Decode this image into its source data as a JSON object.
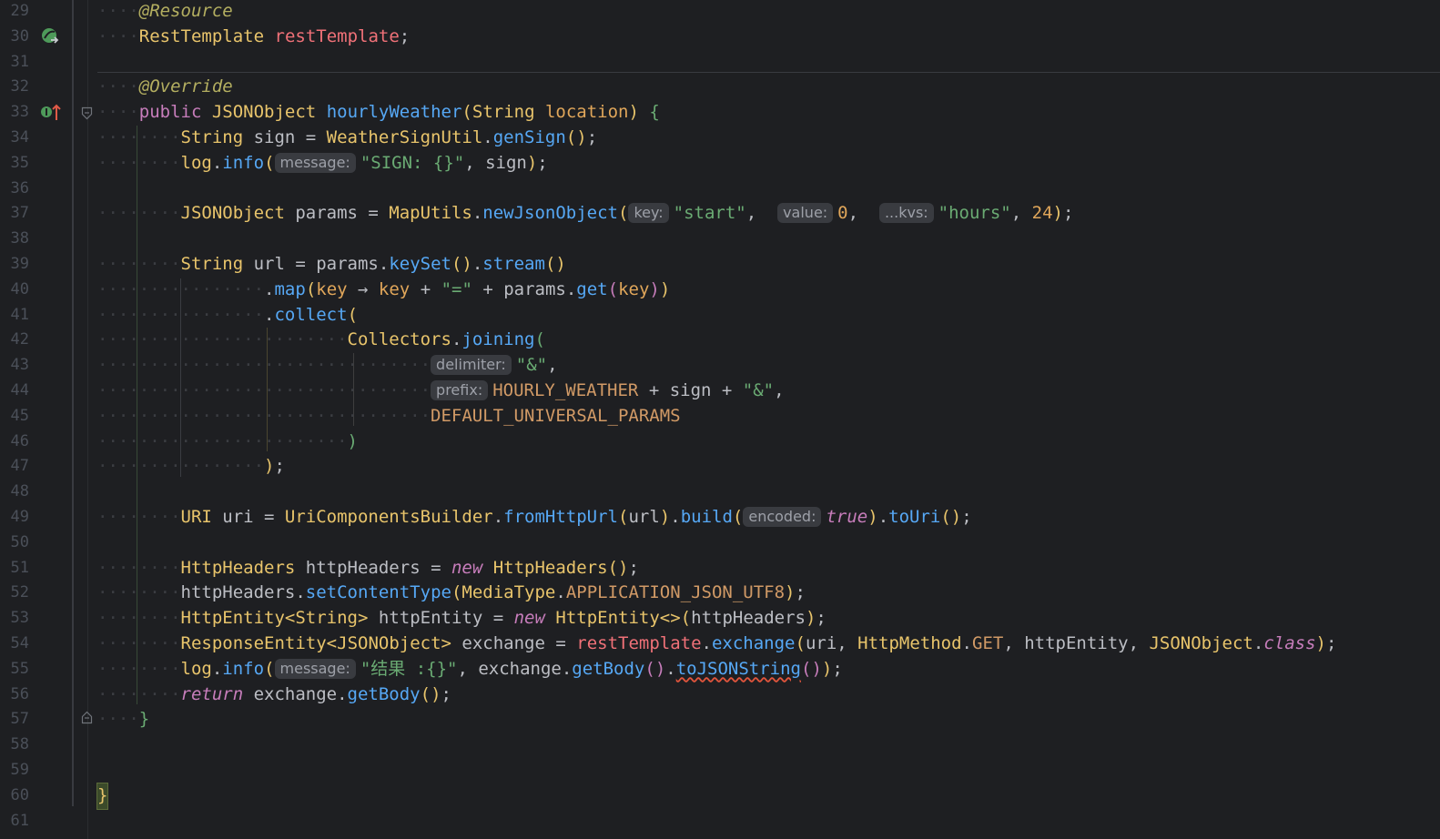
{
  "lines": [
    {
      "n": "29",
      "tokens": [
        [
          "ann",
          "@Resource"
        ]
      ]
    },
    {
      "n": "30",
      "tokens": [
        [
          "type",
          "RestTemplate"
        ],
        [
          "plain",
          " "
        ],
        [
          "field",
          "restTemplate"
        ],
        [
          "plain",
          ";"
        ]
      ]
    },
    {
      "n": "31",
      "tokens": []
    },
    {
      "n": "32",
      "tokens": [
        [
          "ann",
          "@Override"
        ]
      ]
    },
    {
      "n": "33",
      "tokens": [
        [
          "kwp",
          "public"
        ],
        [
          "plain",
          " "
        ],
        [
          "type",
          "JSONObject"
        ],
        [
          "plain",
          " "
        ],
        [
          "method",
          "hourlyWeather"
        ],
        [
          "b1",
          "("
        ],
        [
          "type",
          "String"
        ],
        [
          "plain",
          " "
        ],
        [
          "param",
          "location"
        ],
        [
          "b1",
          ")"
        ],
        [
          "plain",
          " "
        ],
        [
          "b3",
          "{"
        ]
      ]
    },
    {
      "n": "34",
      "tokens": [
        [
          "type",
          "String"
        ],
        [
          "plain",
          " sign = "
        ],
        [
          "type",
          "WeatherSignUtil"
        ],
        [
          "plain",
          "."
        ],
        [
          "method",
          "genSign"
        ],
        [
          "b1",
          "()"
        ],
        [
          "plain",
          ";"
        ]
      ]
    },
    {
      "n": "35",
      "tokens": [
        [
          "type",
          "log"
        ],
        [
          "plain",
          "."
        ],
        [
          "method",
          "info"
        ],
        [
          "b1",
          "("
        ],
        [
          "hint",
          "message:"
        ],
        [
          "str",
          "\"SIGN: {}\""
        ],
        [
          "plain",
          ", sign"
        ],
        [
          "b1",
          ")"
        ],
        [
          "plain",
          ";"
        ]
      ]
    },
    {
      "n": "36",
      "tokens": []
    },
    {
      "n": "37",
      "tokens": [
        [
          "type",
          "JSONObject"
        ],
        [
          "plain",
          " params = "
        ],
        [
          "type",
          "MapUtils"
        ],
        [
          "plain",
          "."
        ],
        [
          "method",
          "newJsonObject"
        ],
        [
          "b1",
          "("
        ],
        [
          "hint",
          "key:"
        ],
        [
          "str",
          "\"start\""
        ],
        [
          "plain",
          ",  "
        ],
        [
          "hint",
          "value:"
        ],
        [
          "num",
          "0"
        ],
        [
          "plain",
          ",  "
        ],
        [
          "hint",
          "...kvs:"
        ],
        [
          "str",
          "\"hours\""
        ],
        [
          "plain",
          ", "
        ],
        [
          "num",
          "24"
        ],
        [
          "b1",
          ")"
        ],
        [
          "plain",
          ";"
        ]
      ]
    },
    {
      "n": "38",
      "tokens": []
    },
    {
      "n": "39",
      "tokens": [
        [
          "type",
          "String"
        ],
        [
          "plain",
          " url = params."
        ],
        [
          "method",
          "keySet"
        ],
        [
          "b1",
          "()"
        ],
        [
          "plain",
          "."
        ],
        [
          "method",
          "stream"
        ],
        [
          "b1",
          "()"
        ]
      ]
    },
    {
      "n": "40",
      "tokens": [
        [
          "plain",
          "."
        ],
        [
          "method",
          "map"
        ],
        [
          "b1",
          "("
        ],
        [
          "param",
          "key"
        ],
        [
          "plain",
          " → "
        ],
        [
          "param",
          "key"
        ],
        [
          "plain",
          " + "
        ],
        [
          "str",
          "\"=\""
        ],
        [
          "plain",
          " + params."
        ],
        [
          "method",
          "get"
        ],
        [
          "b2",
          "("
        ],
        [
          "param",
          "key"
        ],
        [
          "b2",
          ")"
        ],
        [
          "b1",
          ")"
        ]
      ]
    },
    {
      "n": "41",
      "tokens": [
        [
          "plain",
          "."
        ],
        [
          "method",
          "collect"
        ],
        [
          "b1",
          "("
        ]
      ]
    },
    {
      "n": "42",
      "tokens": [
        [
          "type",
          "Collectors"
        ],
        [
          "plain",
          "."
        ],
        [
          "method",
          "joining"
        ],
        [
          "b3",
          "("
        ]
      ]
    },
    {
      "n": "43",
      "tokens": [
        [
          "hint",
          "delimiter:"
        ],
        [
          "str",
          "\"&\""
        ],
        [
          "plain",
          ","
        ]
      ]
    },
    {
      "n": "44",
      "tokens": [
        [
          "hint",
          "prefix:"
        ],
        [
          "const",
          "HOURLY_WEATHER"
        ],
        [
          "plain",
          " + sign + "
        ],
        [
          "str",
          "\"&\""
        ],
        [
          "plain",
          ","
        ]
      ]
    },
    {
      "n": "45",
      "tokens": [
        [
          "const",
          "DEFAULT_UNIVERSAL_PARAMS"
        ]
      ]
    },
    {
      "n": "46",
      "tokens": [
        [
          "b3",
          ")"
        ]
      ]
    },
    {
      "n": "47",
      "tokens": [
        [
          "b1",
          ")"
        ],
        [
          "plain",
          ";"
        ]
      ]
    },
    {
      "n": "48",
      "tokens": []
    },
    {
      "n": "49",
      "tokens": [
        [
          "type",
          "URI"
        ],
        [
          "plain",
          " uri = "
        ],
        [
          "type",
          "UriComponentsBuilder"
        ],
        [
          "plain",
          "."
        ],
        [
          "method",
          "fromHttpUrl"
        ],
        [
          "b1",
          "("
        ],
        [
          "plain",
          "url"
        ],
        [
          "b1",
          ")"
        ],
        [
          "plain",
          "."
        ],
        [
          "method",
          "build"
        ],
        [
          "b1",
          "("
        ],
        [
          "hint",
          "encoded:"
        ],
        [
          "kwi",
          "true"
        ],
        [
          "b1",
          ")"
        ],
        [
          "plain",
          "."
        ],
        [
          "method",
          "toUri"
        ],
        [
          "b1",
          "()"
        ],
        [
          "plain",
          ";"
        ]
      ]
    },
    {
      "n": "50",
      "tokens": []
    },
    {
      "n": "51",
      "tokens": [
        [
          "type",
          "HttpHeaders"
        ],
        [
          "plain",
          " httpHeaders = "
        ],
        [
          "kwi",
          "new"
        ],
        [
          "plain",
          " "
        ],
        [
          "type",
          "HttpHeaders"
        ],
        [
          "b1",
          "()"
        ],
        [
          "plain",
          ";"
        ]
      ]
    },
    {
      "n": "52",
      "tokens": [
        [
          "plain",
          "httpHeaders."
        ],
        [
          "method",
          "setContentType"
        ],
        [
          "b1",
          "("
        ],
        [
          "type",
          "MediaType"
        ],
        [
          "plain",
          "."
        ],
        [
          "const",
          "APPLICATION_JSON_UTF8"
        ],
        [
          "b1",
          ")"
        ],
        [
          "plain",
          ";"
        ]
      ]
    },
    {
      "n": "53",
      "tokens": [
        [
          "type",
          "HttpEntity"
        ],
        [
          "b1",
          "<"
        ],
        [
          "type",
          "String"
        ],
        [
          "b1",
          ">"
        ],
        [
          "plain",
          " httpEntity = "
        ],
        [
          "kwi",
          "new"
        ],
        [
          "plain",
          " "
        ],
        [
          "type",
          "HttpEntity"
        ],
        [
          "b1",
          "<>"
        ],
        [
          "b1",
          "("
        ],
        [
          "plain",
          "httpHeaders"
        ],
        [
          "b1",
          ")"
        ],
        [
          "plain",
          ";"
        ]
      ]
    },
    {
      "n": "54",
      "tokens": [
        [
          "type",
          "ResponseEntity"
        ],
        [
          "b1",
          "<"
        ],
        [
          "type",
          "JSONObject"
        ],
        [
          "b1",
          ">"
        ],
        [
          "plain",
          " exchange = "
        ],
        [
          "field",
          "restTemplate"
        ],
        [
          "plain",
          "."
        ],
        [
          "method",
          "exchange"
        ],
        [
          "b1",
          "("
        ],
        [
          "plain",
          "uri, "
        ],
        [
          "type",
          "HttpMethod"
        ],
        [
          "plain",
          "."
        ],
        [
          "const",
          "GET"
        ],
        [
          "plain",
          ", httpEntity, "
        ],
        [
          "type",
          "JSONObject"
        ],
        [
          "plain",
          "."
        ],
        [
          "kwi",
          "class"
        ],
        [
          "b1",
          ")"
        ],
        [
          "plain",
          ";"
        ]
      ]
    },
    {
      "n": "55",
      "tokens": [
        [
          "type",
          "log"
        ],
        [
          "plain",
          "."
        ],
        [
          "method",
          "info"
        ],
        [
          "b1",
          "("
        ],
        [
          "hint",
          "message:"
        ],
        [
          "str",
          "\"结果 :{}\""
        ],
        [
          "plain",
          ", exchange."
        ],
        [
          "method",
          "getBody"
        ],
        [
          "b2",
          "()"
        ],
        [
          "plain",
          "."
        ],
        [
          "squig",
          "toJSONString"
        ],
        [
          "b2",
          "()"
        ],
        [
          "b1",
          ")"
        ],
        [
          "plain",
          ";"
        ]
      ]
    },
    {
      "n": "56",
      "tokens": [
        [
          "kwi",
          "return"
        ],
        [
          "plain",
          " exchange."
        ],
        [
          "method",
          "getBody"
        ],
        [
          "b1",
          "()"
        ],
        [
          "plain",
          ";"
        ]
      ]
    },
    {
      "n": "57",
      "tokens": [
        [
          "b3",
          "}"
        ]
      ]
    },
    {
      "n": "58",
      "tokens": []
    },
    {
      "n": "59",
      "tokens": []
    },
    {
      "n": "60",
      "tokens": [
        [
          "bracehl",
          "}"
        ]
      ]
    },
    {
      "n": "61",
      "tokens": []
    }
  ],
  "colors": {
    "background": "#1e1f22",
    "annotation": "#b3ae60",
    "type": "#e8c46b",
    "method": "#56a8f5",
    "string": "#6aab73",
    "field": "#f07178"
  },
  "icons": {
    "line30": "spring-bean-icon",
    "line33": "implements-method-icon"
  }
}
